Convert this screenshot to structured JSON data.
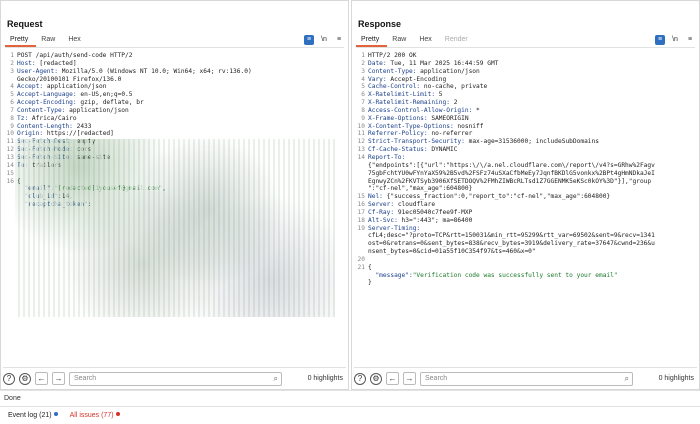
{
  "request": {
    "title": "Request",
    "tabs": [
      "Pretty",
      "Raw",
      "Hex"
    ],
    "lines": [
      {
        "n": "1",
        "t": "POST /api/auth/send-code HTTP/2",
        "c": "v"
      },
      {
        "n": "2",
        "k": "Host: ",
        "t": "[redacted]"
      },
      {
        "n": "3",
        "k": "User-Agent: ",
        "t": "Mozilla/5.0 (Windows NT 10.0; Win64; x64; rv:136.0)"
      },
      {
        "n": "",
        "t": "Gecko/20100101 Firefox/136.0",
        "c": "v"
      },
      {
        "n": "4",
        "k": "Accept: ",
        "t": "application/json"
      },
      {
        "n": "5",
        "k": "Accept-Language: ",
        "t": "en-US,en;q=0.5"
      },
      {
        "n": "6",
        "k": "Accept-Encoding: ",
        "t": "gzip, deflate, br"
      },
      {
        "n": "7",
        "k": "Content-Type: ",
        "t": "application/json"
      },
      {
        "n": "8",
        "k": "Tz: ",
        "t": "Africa/Cairo"
      },
      {
        "n": "9",
        "k": "Content-Length: ",
        "t": "2433"
      },
      {
        "n": "10",
        "k": "Origin: ",
        "t": "https://[redacted]"
      },
      {
        "n": "11",
        "k": "Sec-Fetch-Dest: ",
        "t": "empty"
      },
      {
        "n": "12",
        "k": "Sec-Fetch-Mode: ",
        "t": "cors"
      },
      {
        "n": "13",
        "k": "Sec-Fetch-Site: ",
        "t": "same-site"
      },
      {
        "n": "14",
        "k": "Te: ",
        "t": "trailers"
      },
      {
        "n": "15",
        "t": "",
        "c": "v"
      },
      {
        "n": "16",
        "t": "{",
        "c": "v"
      },
      {
        "n": "",
        "jk": "  \"email\":",
        "t": "\"[redacted]1yousef@gmail.com\",",
        "c": "s"
      },
      {
        "n": "",
        "jk": "  \"club_id\":",
        "t": "14,",
        "c": "v"
      },
      {
        "n": "",
        "jk": "  \"recaptcha_token\":",
        "t": "",
        "c": "v"
      }
    ],
    "search_placeholder": "Search",
    "highlights": "0 highlights"
  },
  "response": {
    "title": "Response",
    "tabs": [
      "Pretty",
      "Raw",
      "Hex",
      "Render"
    ],
    "lines": [
      {
        "n": "1",
        "t": "HTTP/2 200 OK",
        "c": "v"
      },
      {
        "n": "2",
        "k": "Date: ",
        "t": "Tue, 11 Mar 2025 16:44:59 GMT"
      },
      {
        "n": "3",
        "k": "Content-Type: ",
        "t": "application/json"
      },
      {
        "n": "4",
        "k": "Vary: ",
        "t": "Accept-Encoding"
      },
      {
        "n": "5",
        "k": "Cache-Control: ",
        "t": "no-cache, private"
      },
      {
        "n": "6",
        "k": "X-Ratelimit-Limit: ",
        "t": "5"
      },
      {
        "n": "7",
        "k": "X-Ratelimit-Remaining: ",
        "t": "2"
      },
      {
        "n": "8",
        "k": "Access-Control-Allow-Origin: ",
        "t": "*"
      },
      {
        "n": "9",
        "k": "X-Frame-Options: ",
        "t": "SAMEORIGIN"
      },
      {
        "n": "10",
        "k": "X-Content-Type-Options: ",
        "t": "nosniff"
      },
      {
        "n": "11",
        "k": "Referrer-Policy: ",
        "t": "no-referrer"
      },
      {
        "n": "12",
        "k": "Strict-Transport-Security: ",
        "t": "max-age=31536000; includeSubDomains"
      },
      {
        "n": "13",
        "k": "Cf-Cache-Status: ",
        "t": "DYNAMIC"
      },
      {
        "n": "14",
        "k": "Report-To: ",
        "t": ""
      },
      {
        "n": "",
        "t": "{\"endpoints\":[{\"url\":\"https:\\/\\/a.nel.cloudflare.com\\/report\\/v4?s=GRhw%2Fagv",
        "c": "v"
      },
      {
        "n": "",
        "t": "75gbFchtYU0wFYnYaX59%2B5vd%2FSFz74uSXaCfbMeEy7JqnfBKDlG5vonkx%2BPt4gHmNDkaJeI",
        "c": "v"
      },
      {
        "n": "",
        "t": "EgnwyZCn%2FKVTSyb3906XfSETDOQV%2FMhZIWBcRLTsd1Z7GGENMK5eKSc0kOY%3D\"}],\"group",
        "c": "v"
      },
      {
        "n": "",
        "t": "\":\"cf-nel\",\"max_age\":604800}",
        "c": "v"
      },
      {
        "n": "15",
        "k": "Nel: ",
        "t": "{\"success_fraction\":0,\"report_to\":\"cf-nel\",\"max_age\":604800}"
      },
      {
        "n": "16",
        "k": "Server: ",
        "t": "cloudflare"
      },
      {
        "n": "17",
        "k": "Cf-Ray: ",
        "t": "91ec05040c7fee9f-MXP"
      },
      {
        "n": "18",
        "k": "Alt-Svc: ",
        "t": "h3=\":443\"; ma=86400"
      },
      {
        "n": "19",
        "k": "Server-Timing: ",
        "t": ""
      },
      {
        "n": "",
        "t": "cfL4;desc=\"?proto=TCP&rtt=150031&min_rtt=95299&rtt_var=69502&sent=9&recv=1341",
        "c": "v"
      },
      {
        "n": "",
        "t": "ost=0&retrans=0&sent_bytes=838&recv_bytes=3919&delivery_rate=37647&cwnd=236&u",
        "c": "v"
      },
      {
        "n": "",
        "t": "nsent_bytes=0&cid=01a55f10C354f97&ts=460&x=0\"",
        "c": "v"
      },
      {
        "n": "20",
        "t": "",
        "c": "v"
      },
      {
        "n": "21",
        "t": "{",
        "c": "v"
      },
      {
        "n": "",
        "jk": "  \"message\":",
        "t": "\"Verification code was successfully sent to your email\"",
        "c": "s"
      },
      {
        "n": "",
        "t": "}",
        "c": "v"
      }
    ],
    "search_placeholder": "Search",
    "highlights": "0 highlights"
  },
  "status_text": "Done",
  "footer": {
    "event_log": "Event log (21)",
    "event_log_dot_color": "#2f6fbf",
    "issues": "All issues (77)",
    "issues_color": "#d0342c",
    "issues_dot_color": "#d0342c"
  },
  "accent_color": "#e2643a"
}
